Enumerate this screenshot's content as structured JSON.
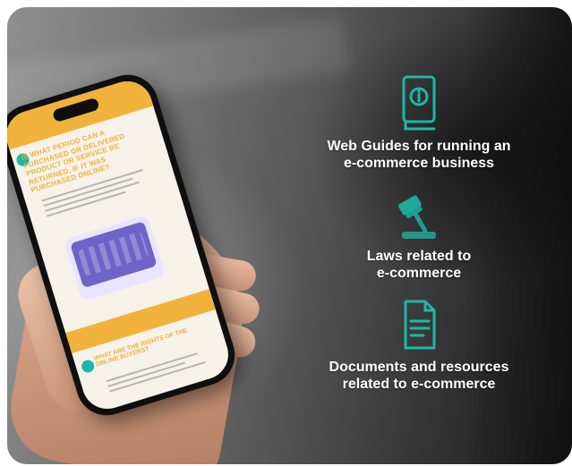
{
  "features": [
    {
      "icon": "info-book-icon",
      "text": "Web Guides for running an\ne-commerce business"
    },
    {
      "icon": "gavel-icon",
      "text": "Laws related to\ne-commerce"
    },
    {
      "icon": "document-icon",
      "text": "Documents and resources\nrelated to e-commerce"
    }
  ],
  "phone": {
    "doc_title": "IS WHAT PERIOD CAN A PURCHASED OR DELIVERED PRODUCT OR SERVICE BE RETURNED, IF IT WAS PURCHASED ONLINE?",
    "doc_subtitle": "WHAT ARE THE RIGHTS OF THE ONLINE BUYERS?"
  },
  "colors": {
    "accent_teal": "#1cb7a8",
    "doc_orange": "#f0b23a",
    "text_white": "#ffffff"
  }
}
